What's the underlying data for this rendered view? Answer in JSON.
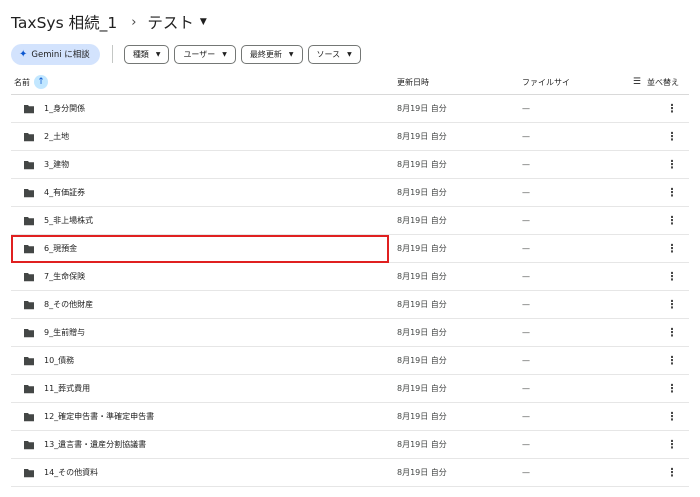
{
  "breadcrumb": {
    "root": "TaxSys 相続_1",
    "separator": "›",
    "current": "テスト"
  },
  "filters": {
    "gemini_label": "Gemini に相談",
    "chips": [
      {
        "label": "種類"
      },
      {
        "label": "ユーザー"
      },
      {
        "label": "最終更新"
      },
      {
        "label": "ソース"
      }
    ]
  },
  "header": {
    "name": "名前",
    "modified": "更新日時",
    "size": "ファイルサイ",
    "sort": "並べ替え"
  },
  "rows": [
    {
      "name": "1_身分関係",
      "date": "8月19日 自分",
      "size": "—"
    },
    {
      "name": "2_土地",
      "date": "8月19日 自分",
      "size": "—"
    },
    {
      "name": "3_建物",
      "date": "8月19日 自分",
      "size": "—"
    },
    {
      "name": "4_有価証券",
      "date": "8月19日 自分",
      "size": "—"
    },
    {
      "name": "5_非上場株式",
      "date": "8月19日 自分",
      "size": "—"
    },
    {
      "name": "6_現預金",
      "date": "8月19日 自分",
      "size": "—"
    },
    {
      "name": "7_生命保険",
      "date": "8月19日 自分",
      "size": "—"
    },
    {
      "name": "8_その他財産",
      "date": "8月19日 自分",
      "size": "—"
    },
    {
      "name": "9_生前贈与",
      "date": "8月19日 自分",
      "size": "—"
    },
    {
      "name": "10_債務",
      "date": "8月19日 自分",
      "size": "—"
    },
    {
      "name": "11_葬式費用",
      "date": "8月19日 自分",
      "size": "—"
    },
    {
      "name": "12_確定申告書・準確定申告書",
      "date": "8月19日 自分",
      "size": "—"
    },
    {
      "name": "13_遺言書・遺産分割協議書",
      "date": "8月19日 自分",
      "size": "—"
    },
    {
      "name": "14_その他資料",
      "date": "8月19日 自分",
      "size": "—"
    }
  ],
  "icons": {
    "folder": "folder-icon",
    "more": "more-vert-icon",
    "sort_arrow": "arrow-up-icon",
    "gemini": "sparkle-icon"
  },
  "colors": {
    "accent": "#0b57d0",
    "gemini_bg": "#d3e3fd",
    "sort_bg": "#c2e7ff",
    "highlight": "#e02020"
  }
}
